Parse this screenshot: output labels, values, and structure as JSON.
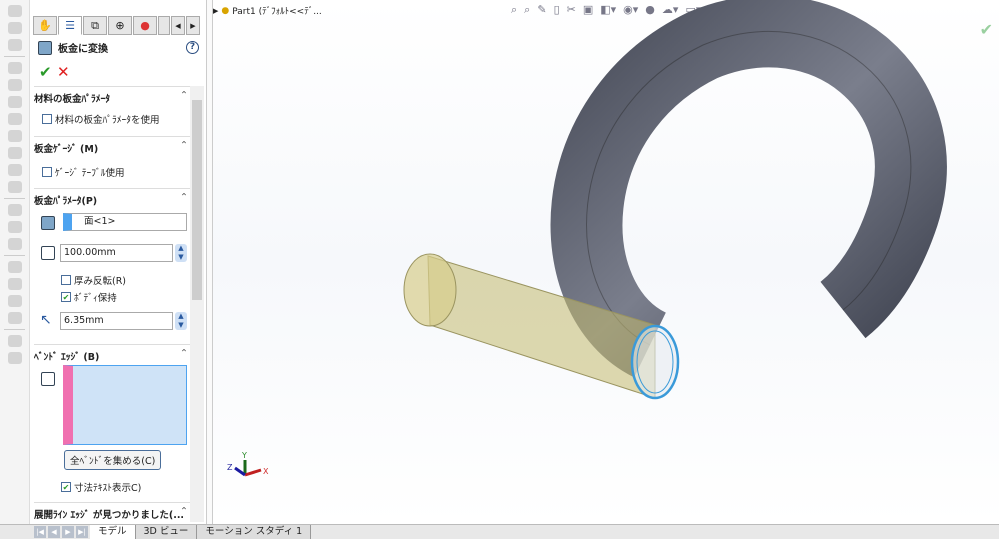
{
  "panel": {
    "title": "板金に変換",
    "help": "?",
    "ok": "✔",
    "cancel": "✕",
    "sections": {
      "material": {
        "header": "材料の板金ﾊﾟﾗﾒｰﾀ",
        "checkbox": "材料の板金ﾊﾟﾗﾒｰﾀを使用",
        "checked": false
      },
      "gauge": {
        "header": "板金ｹﾞｰｼﾞ (M)",
        "checkbox": "ｹﾞｰｼﾞ ﾃｰﾌﾞﾙ使用",
        "checked": false
      },
      "params": {
        "header": "板金ﾊﾟﾗﾒｰﾀ(P)",
        "face": "面<1>",
        "thickness": "100.00mm",
        "reverse": "厚み反転(R)",
        "reverse_checked": false,
        "keep_body": "ﾎﾞﾃﾞｨ保持",
        "keep_body_checked": true,
        "radius": "6.35mm"
      },
      "bend": {
        "header": "ﾍﾞﾝﾄﾞ ｴｯｼﾞ (B)",
        "collect_button": "全ﾍﾞﾝﾄﾞを集める(C)",
        "dim_text": "寸法ﾃｷｽﾄ表示C)",
        "dim_checked": true
      },
      "rip": {
        "header": "展開ﾗｲﾝ ｴｯｼﾞ が見つかりました(..."
      }
    }
  },
  "viewport": {
    "tree_label": "Part1  (ﾃﾞﾌｫﾙﾄ<<ﾃﾞ...",
    "axes": {
      "x": "X",
      "y": "Y",
      "z": "Z"
    }
  },
  "bottom_tabs": [
    "モデル",
    "3D ビュー",
    "モーション スタディ 1"
  ],
  "colors": {
    "accent": "#3a9ad9",
    "body": "#5a5e6b",
    "check": "#2a9a2a"
  }
}
